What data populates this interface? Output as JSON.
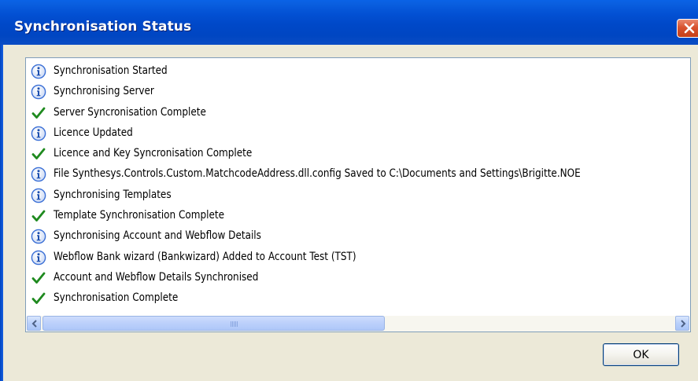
{
  "window": {
    "title": "Synchronisation Status"
  },
  "log": {
    "entries": [
      {
        "status": "info",
        "icon": "info-icon",
        "text": "Synchronisation Started"
      },
      {
        "status": "info",
        "icon": "info-icon",
        "text": "Synchronising Server"
      },
      {
        "status": "success",
        "icon": "checkmark-icon",
        "text": "Server Syncronisation Complete"
      },
      {
        "status": "info",
        "icon": "info-icon",
        "text": "Licence Updated"
      },
      {
        "status": "success",
        "icon": "checkmark-icon",
        "text": "Licence and Key Syncronisation Complete"
      },
      {
        "status": "info",
        "icon": "info-icon",
        "text": "File Synthesys.Controls.Custom.MatchcodeAddress.dll.config Saved to C:\\Documents and Settings\\Brigitte.NOE"
      },
      {
        "status": "info",
        "icon": "info-icon",
        "text": "Synchronising Templates"
      },
      {
        "status": "success",
        "icon": "checkmark-icon",
        "text": "Template Synchronisation Complete"
      },
      {
        "status": "info",
        "icon": "info-icon",
        "text": "Synchronising Account and Webflow Details"
      },
      {
        "status": "info",
        "icon": "info-icon",
        "text": "Webflow Bank wizard (Bankwizard) Added to Account Test (TST)"
      },
      {
        "status": "success",
        "icon": "checkmark-icon",
        "text": "Account and Webflow Details Synchronised"
      },
      {
        "status": "success",
        "icon": "checkmark-icon",
        "text": "Synchronisation Complete"
      }
    ]
  },
  "buttons": {
    "ok_label": "OK"
  },
  "colors": {
    "title_bar": "#0351d4",
    "close_button": "#d8532f",
    "info_icon": "#3a6fd6",
    "check_icon": "#1f8a1f"
  }
}
